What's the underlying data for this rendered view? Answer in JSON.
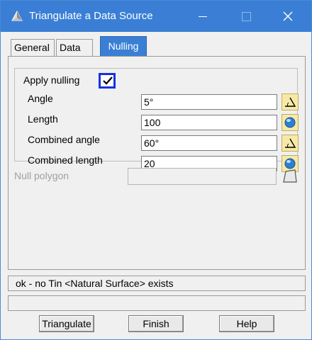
{
  "window": {
    "title": "Triangulate a Data Source",
    "icons": {
      "app": "triangle-app-icon",
      "minimize": "minimize-icon",
      "maximize": "maximize-icon",
      "close": "close-icon"
    }
  },
  "tabs": [
    {
      "label": "General",
      "active": false
    },
    {
      "label": "Data",
      "active": false
    },
    {
      "label": "Nulling",
      "active": true
    }
  ],
  "nulling": {
    "apply_label": "Apply nulling",
    "apply_checked": true,
    "rows": [
      {
        "label": "Angle",
        "value": "5°",
        "button_icon": "angle-pick-icon"
      },
      {
        "label": "Length",
        "value": "100",
        "button_icon": "globe-icon"
      },
      {
        "label": "Combined angle",
        "value": "60°",
        "button_icon": "angle-pick-icon"
      },
      {
        "label": "Combined length",
        "value": "20",
        "button_icon": "globe-icon"
      }
    ],
    "null_polygon_label": "Null polygon",
    "null_polygon_value": ""
  },
  "status": {
    "message": "ok - no Tin <Natural Surface> exists",
    "secondary": ""
  },
  "buttons": {
    "triangulate": "Triangulate",
    "finish": "Finish",
    "help": "Help"
  },
  "colors": {
    "titlebar": "#3a7fd5",
    "active_tab": "#3a7fd5",
    "checkbox_border": "#1233e0",
    "pick_button": "#f6e9a8"
  }
}
